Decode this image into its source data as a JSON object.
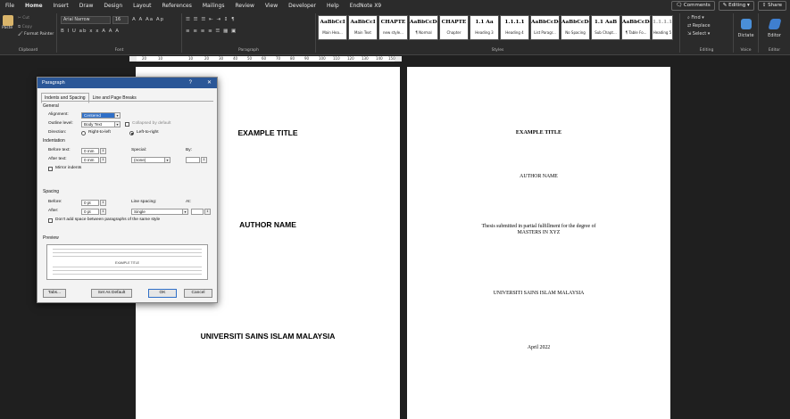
{
  "menubar": {
    "tabs": [
      "File",
      "Home",
      "Insert",
      "Draw",
      "Design",
      "Layout",
      "References",
      "Mailings",
      "Review",
      "View",
      "Developer",
      "Help",
      "EndNote X9"
    ],
    "active_tab": "Home",
    "comments_label": "Comments",
    "editing_label": "Editing",
    "share_label": "Share"
  },
  "ribbon": {
    "clipboard": {
      "paste_label": "Paste",
      "cut_label": "Cut",
      "copy_label": "Copy",
      "format_painter_label": "Format Painter",
      "group_label": "Clipboard"
    },
    "font": {
      "font_name": "Arial Narrow",
      "font_size": "16",
      "group_label": "Font"
    },
    "paragraph": {
      "group_label": "Paragraph"
    },
    "styles": {
      "group_label": "Styles",
      "items": [
        {
          "preview": "AaBbCcI",
          "name": "Main Hea..."
        },
        {
          "preview": "AaBbCcI",
          "name": "Main Text"
        },
        {
          "preview": "CHAPTE",
          "name": "new style..."
        },
        {
          "preview": "AaBbCcDc",
          "name": "¶ Normal"
        },
        {
          "preview": "CHAPTE",
          "name": "Chapter"
        },
        {
          "preview": "1.1 Aa",
          "name": "Heading 3"
        },
        {
          "preview": "1.1.1.1",
          "name": "Heading 4"
        },
        {
          "preview": "AaBbCcDc",
          "name": "List Paragr..."
        },
        {
          "preview": "AaBbCcDc",
          "name": "No Spacing"
        },
        {
          "preview": "1.1 AaB",
          "name": "Sub Chapt..."
        },
        {
          "preview": "AaBbCcDc",
          "name": "¶ Table Fo..."
        },
        {
          "preview": "1.1.1.1",
          "name": "Heading 5"
        }
      ]
    },
    "editing": {
      "find_label": "Find",
      "replace_label": "Replace",
      "select_label": "Select",
      "group_label": "Editing"
    },
    "voice": {
      "dictate_label": "Dictate",
      "group_label": "Voice"
    },
    "editor": {
      "editor_label": "Editor",
      "group_label": "Editor"
    }
  },
  "ruler": {
    "ticks": [
      "20",
      "10",
      "10",
      "20",
      "30",
      "40",
      "50",
      "60",
      "70",
      "80",
      "90",
      "100",
      "110",
      "120",
      "130",
      "140",
      "150"
    ]
  },
  "dialog": {
    "title": "Paragraph",
    "help": "?",
    "close": "✕",
    "tabs": [
      "Indents and Spacing",
      "Line and Page Breaks"
    ],
    "general_label": "General",
    "alignment_label": "Alignment:",
    "alignment_value": "Centered",
    "outline_label": "Outline level:",
    "outline_value": "Body Text",
    "collapsed_label": "Collapsed by default",
    "direction_label": "Direction:",
    "rtl_label": "Right-to-left",
    "ltr_label": "Left-to-right",
    "indentation_label": "Indentation",
    "before_text_label": "Before text:",
    "before_text_value": "0 mm",
    "after_text_label": "After text:",
    "after_text_value": "0 mm",
    "special_label": "Special:",
    "special_value": "(none)",
    "by_label": "By:",
    "mirror_label": "Mirror indents",
    "spacing_label": "Spacing",
    "before_label": "Before:",
    "before_value": "0 pt",
    "after_label": "After:",
    "after_value": "0 pt",
    "line_spacing_label": "Line spacing:",
    "line_spacing_value": "Single",
    "at_label": "At:",
    "dont_add_label": "Don't add space between paragraphs of the same style",
    "preview_label": "Preview",
    "preview_sample": "EXAMPLE TITLE",
    "tabs_button": "Tabs...",
    "default_button": "Set As Default",
    "ok_button": "OK",
    "cancel_button": "Cancel"
  },
  "page1": {
    "title": "EXAMPLE TITLE",
    "author": "AUTHOR NAME",
    "university": "UNIVERSITI SAINS ISLAM MALAYSIA"
  },
  "page2": {
    "title": "EXAMPLE TITLE",
    "author": "AUTHOR NAME",
    "thesis_line1": "Thesis submitted in partial fulfillment for the degree of",
    "thesis_line2": "MASTERS IN XYZ",
    "university": "UNIVERSITI SAINS ISLAM MALAYSIA",
    "date": "April 2022"
  }
}
